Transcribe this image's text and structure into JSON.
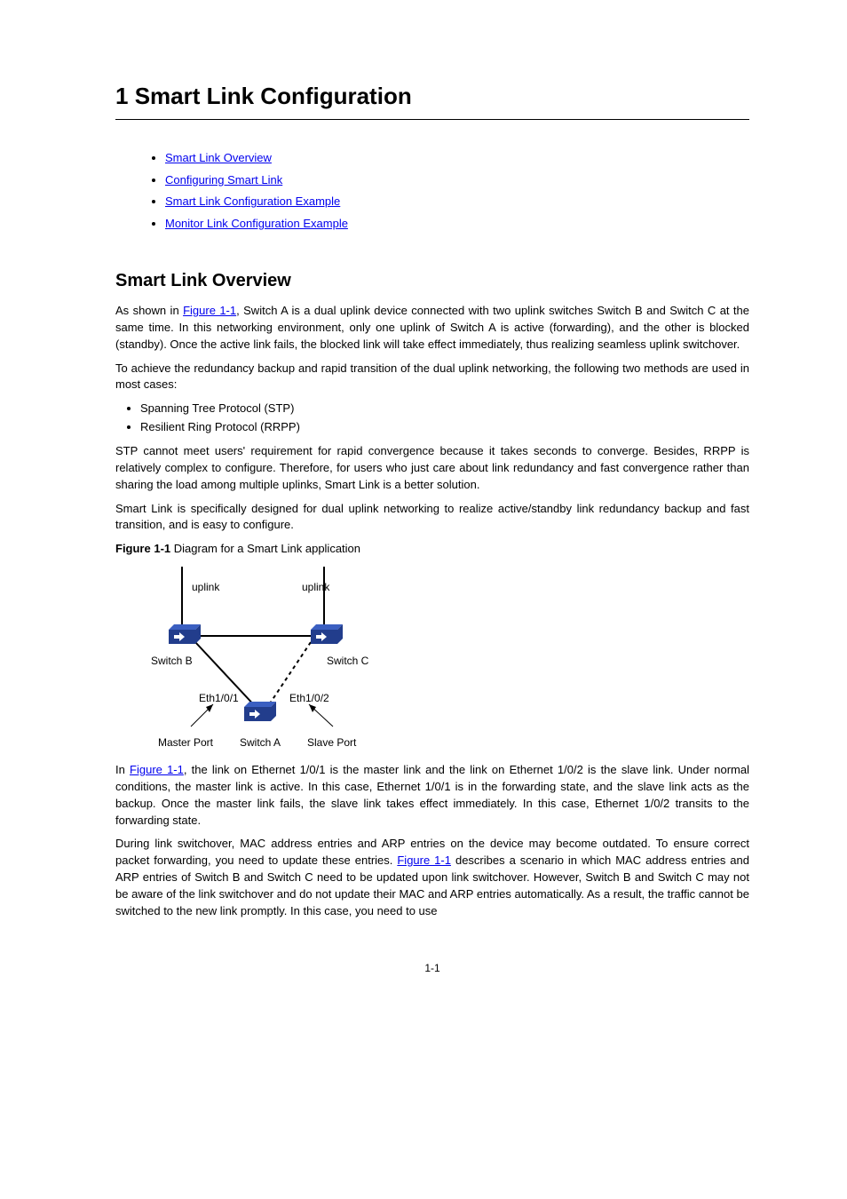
{
  "chapter": {
    "number": "1",
    "title": "Smart Link Configuration"
  },
  "toc": [
    {
      "text": "Smart Link Overview"
    },
    {
      "text": "Configuring Smart Link"
    },
    {
      "text": "Smart Link Configuration Example"
    },
    {
      "text": "Monitor Link Configuration Example"
    }
  ],
  "section1": {
    "heading": "Smart Link Overview",
    "paragraph": [
      "As shown in ",
      {
        "link": "Figure 1-1"
      },
      ", Switch A is a dual uplink device connected with two uplink switches Switch B and Switch C at the same time. In this networking environment, only one uplink of Switch A is active (forwarding), and the other is blocked (standby). Once the active link fails, the blocked link will take effect immediately, thus realizing seamless uplink switchover.",
      "To achieve the redundancy backup and rapid transition of the dual uplink networking, the following two methods are used in most cases:"
    ],
    "bullets": [
      "Spanning Tree Protocol (STP)",
      "Resilient Ring Protocol (RRPP)"
    ],
    "paragraph2": "STP cannot meet users' requirement for rapid convergence because it takes seconds to converge. Besides, RRPP is relatively complex to configure. Therefore, for users who just care about link redundancy and fast convergence rather than sharing the load among multiple uplinks, Smart Link is a better solution.",
    "paragraph3": "Smart Link is specifically designed for dual uplink networking to realize active/standby link redundancy backup and fast transition, and is easy to configure.",
    "figure_caption_label": "Figure 1-1",
    "figure_caption_text": "Diagram for a Smart Link application"
  },
  "diagram": {
    "uplink1": "uplink",
    "uplink2": "uplink",
    "switchB": "Switch B",
    "switchC": "Switch C",
    "switchA": "Switch A",
    "port1": "Eth1/0/1",
    "port2": "Eth1/0/2",
    "master": "Master Port",
    "slave": "Slave Port"
  },
  "section1b": {
    "paragraph4": [
      "In ",
      {
        "link": "Figure 1-1"
      },
      ", the link on Ethernet 1/0/1 is the master link and the link on Ethernet 1/0/2 is the slave link. Under normal conditions, the master link is active. In this case, Ethernet 1/0/1 is in the forwarding state, and the slave link acts as the backup. Once the master link fails, the slave link takes effect immediately. In this case, Ethernet 1/0/2 transits to the forwarding state."
    ],
    "paragraph5": [
      "During link switchover, MAC address entries and ARP entries on the device may become outdated. To ensure correct packet forwarding, you need to update these entries. ",
      {
        "link": "Figure 1-1"
      },
      " describes a scenario in which MAC address entries and ARP entries of Switch B and Switch C need to be updated upon link switchover. However, Switch B and Switch C may not be aware of the link switchover and do not update their MAC and ARP entries automatically. As a result, the traffic cannot be switched to the new link promptly. In this case, you need to use"
    ]
  },
  "page_number": "1-1"
}
